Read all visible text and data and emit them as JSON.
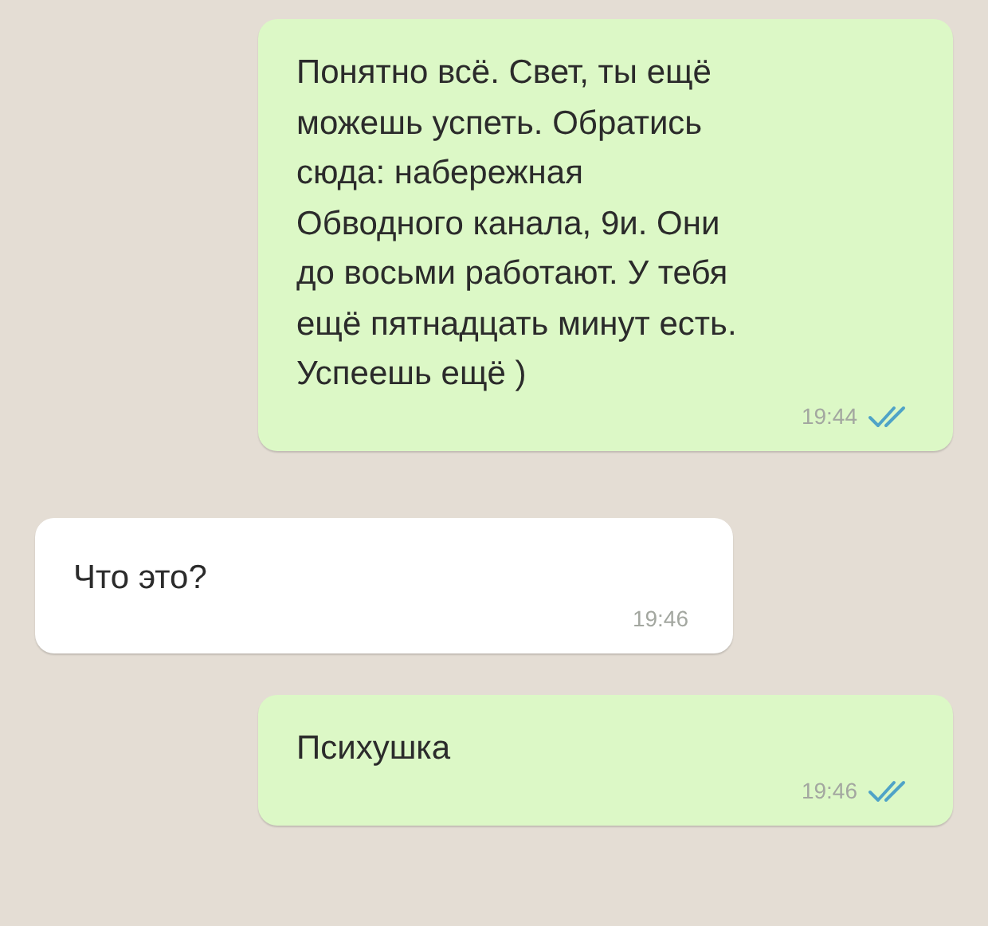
{
  "messages": [
    {
      "kind": "outgoing",
      "text": "Понятно всё. Свет, ты ещё\nможешь успеть. Обратись\nсюда: набережная\nОбводного канала, 9и. Они\nдо восьми работают. У тебя\nещё пятнадцать минут есть.\nУспеешь ещё )",
      "time": "19:44",
      "read": true
    },
    {
      "kind": "incoming",
      "text": "Что это?",
      "time": "19:46"
    },
    {
      "kind": "outgoing",
      "text": "Психушка",
      "time": "19:46",
      "read": true
    }
  ]
}
